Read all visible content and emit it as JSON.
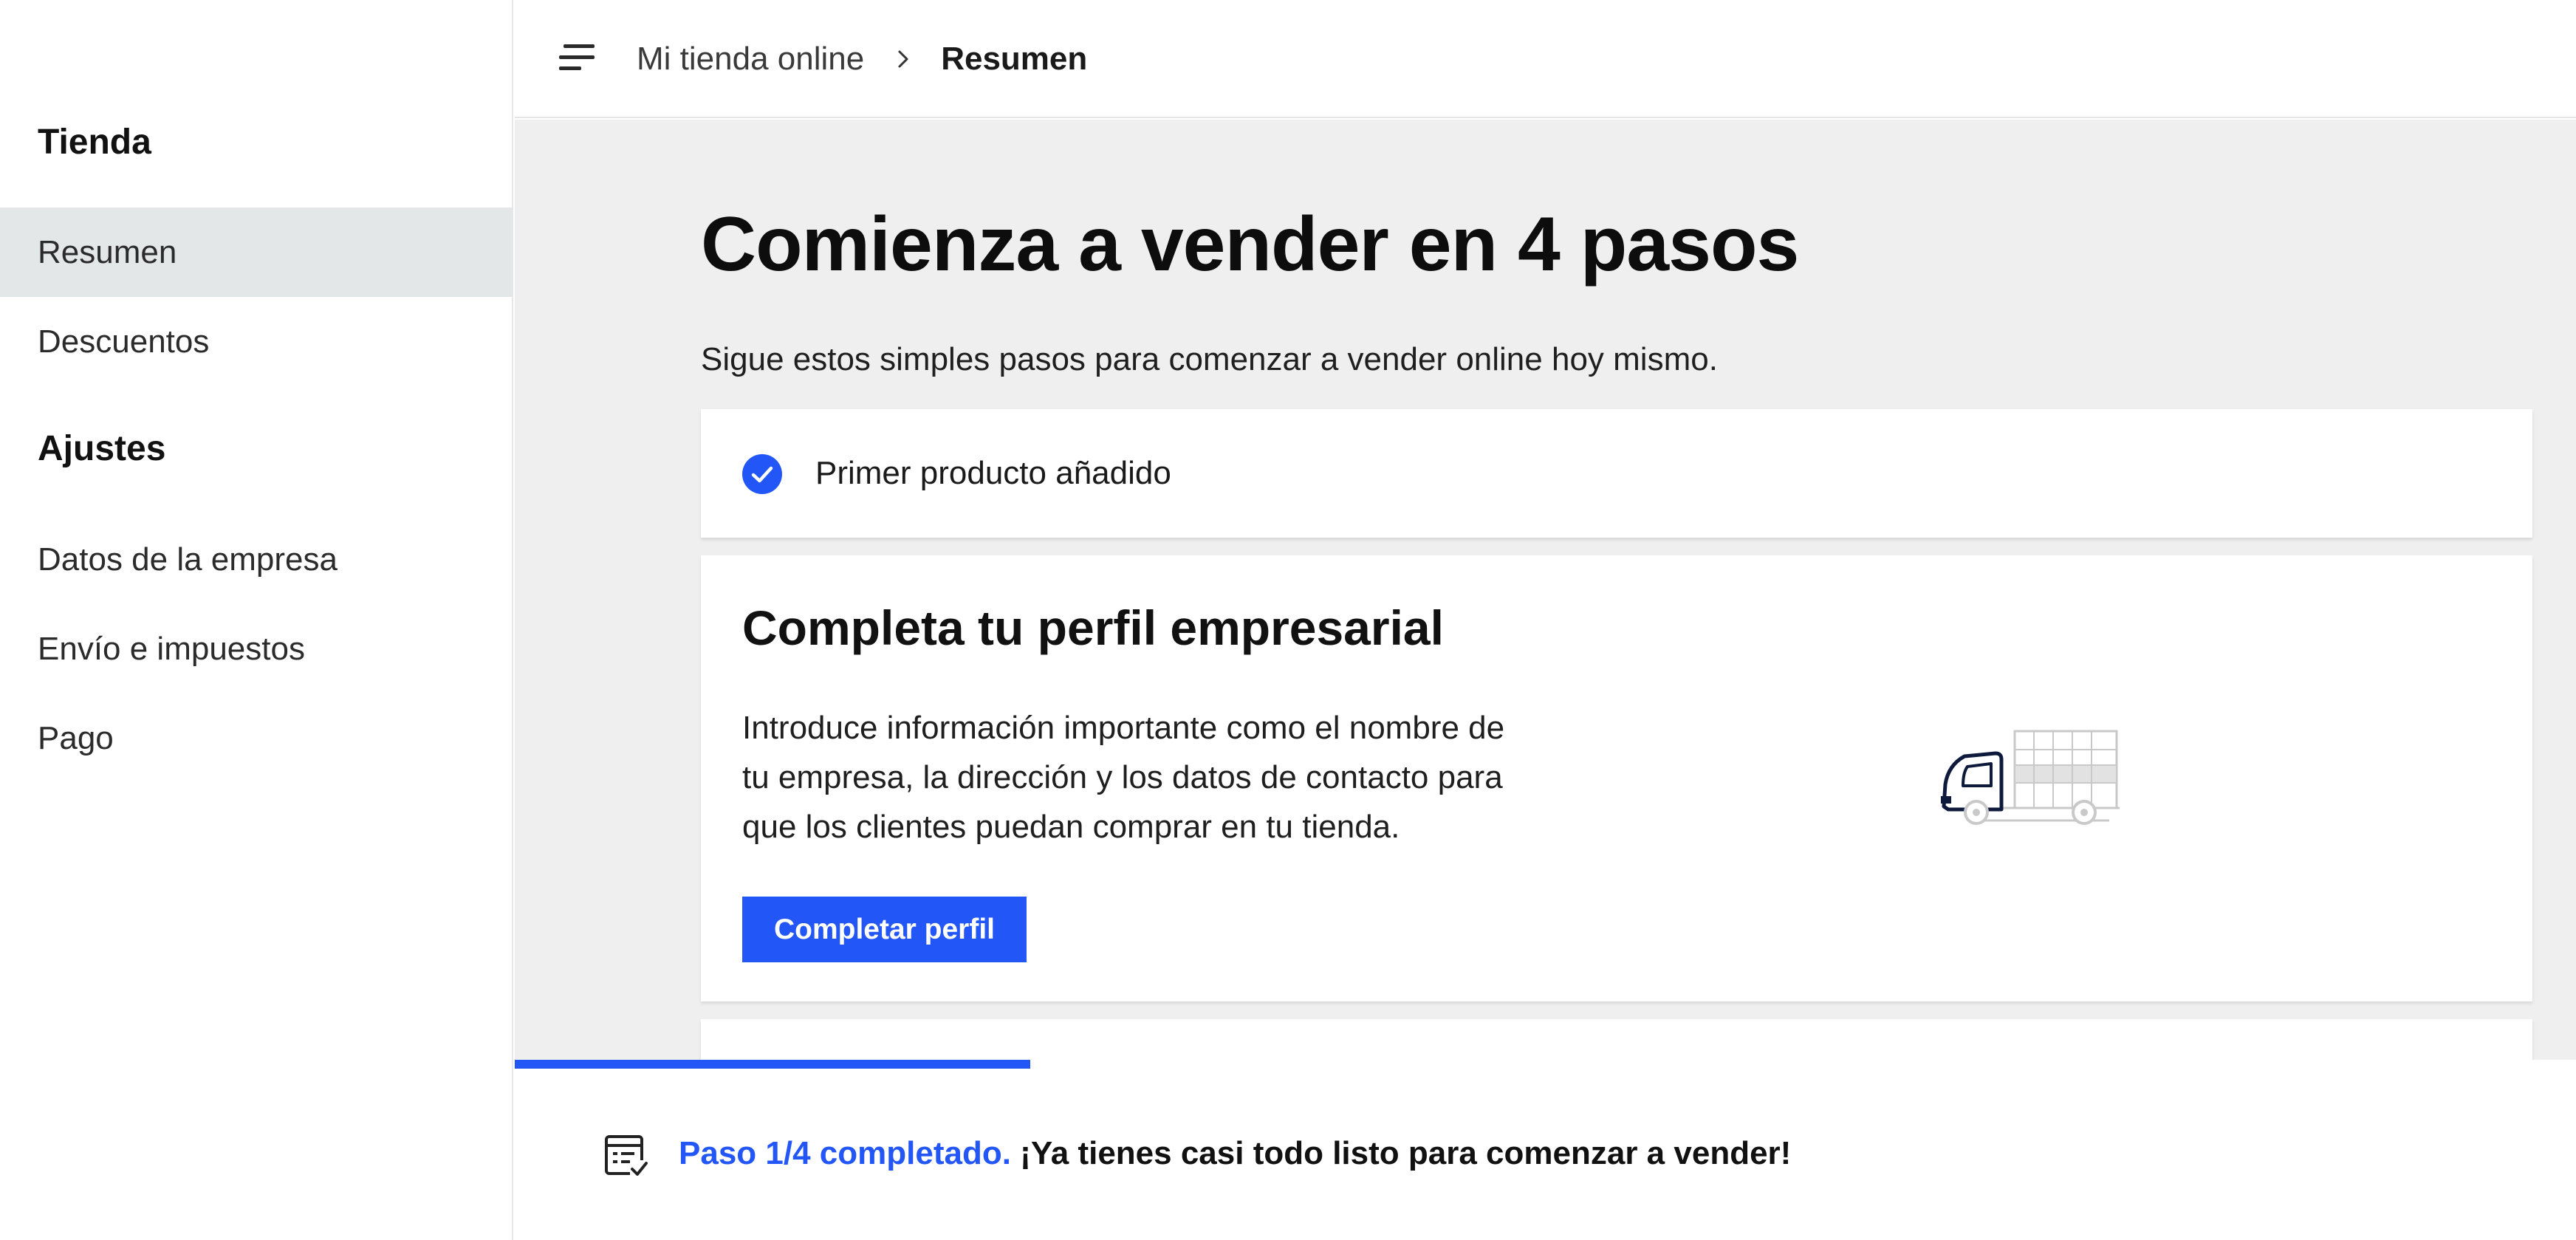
{
  "sidebar": {
    "sections": [
      {
        "title": "Tienda",
        "items": [
          {
            "label": "Resumen",
            "active": true
          },
          {
            "label": "Descuentos",
            "active": false
          }
        ]
      },
      {
        "title": "Ajustes",
        "items": [
          {
            "label": "Datos de la empresa",
            "active": false
          },
          {
            "label": "Envío e impuestos",
            "active": false
          },
          {
            "label": "Pago",
            "active": false
          }
        ]
      }
    ]
  },
  "header": {
    "menu_icon": "menu-lines-icon",
    "breadcrumb": {
      "parent": "Mi tienda online",
      "separator_icon": "chevron-right-icon",
      "current": "Resumen"
    }
  },
  "main": {
    "title": "Comienza a vender en 4 pasos",
    "subtitle": "Sigue estos simples pasos para comenzar a vender online hoy mismo.",
    "completed_step": {
      "icon": "check-circle-icon",
      "label": "Primer producto añadido"
    },
    "profile_card": {
      "title": "Completa tu perfil empresarial",
      "description_lines": [
        "Introduce información importante como el nombre de",
        "tu empresa, la dirección y los datos de contacto para",
        "que los clientes puedan comprar en tu tienda."
      ],
      "button_label": "Completar perfil",
      "illustration": "delivery-truck-illustration"
    }
  },
  "progress": {
    "icon": "checklist-icon",
    "completed_steps": 1,
    "total_steps": 4,
    "fraction": 0.25,
    "step_text": "Paso 1/4 completado.",
    "message": "¡Ya tienes casi todo listo para comenzar a vender!"
  },
  "colors": {
    "accent": "#2356f6",
    "sidebar_active_bg": "#e3e7e8",
    "main_bg": "#efefef",
    "illustration_dark": "#0e1a3b",
    "illustration_light": "#c9c9c9"
  }
}
